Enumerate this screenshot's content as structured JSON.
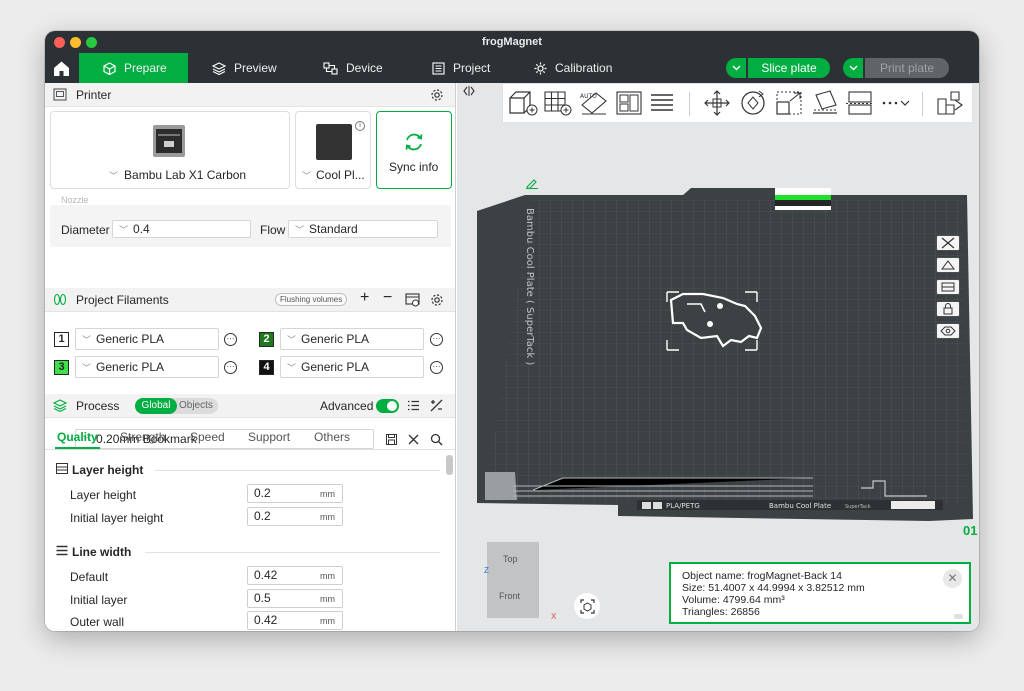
{
  "window": {
    "title": "frogMagnet"
  },
  "topbar": {
    "tabs": [
      {
        "label": "Prepare",
        "icon": "cube-icon",
        "active": true
      },
      {
        "label": "Preview",
        "icon": "layers-icon",
        "active": false
      },
      {
        "label": "Device",
        "icon": "device-icon",
        "active": false
      },
      {
        "label": "Project",
        "icon": "project-icon",
        "active": false
      },
      {
        "label": "Calibration",
        "icon": "calibration-icon",
        "active": false
      }
    ],
    "slice_label": "Slice plate",
    "print_label": "Print plate"
  },
  "printer": {
    "section_label": "Printer",
    "printer_name": "Bambu Lab X1 Carbon",
    "plate_name": "Cool Pl...",
    "sync_label": "Sync info",
    "nozzle_label": "Nozzle",
    "diameter_label": "Diameter",
    "diameter_value": "0.4",
    "flow_label": "Flow",
    "flow_value": "Standard"
  },
  "filaments": {
    "section_label": "Project Filaments",
    "flushing_label": "Flushing volumes",
    "items": [
      {
        "num": "1",
        "name": "Generic PLA",
        "color": "#ffffff",
        "text_color": "#262626"
      },
      {
        "num": "2",
        "name": "Generic PLA",
        "color": "#1f7a1f",
        "text_color": "#ffffff"
      },
      {
        "num": "3",
        "name": "Generic PLA",
        "color": "#3ee14a",
        "text_color": "#262626"
      },
      {
        "num": "4",
        "name": "Generic PLA",
        "color": "#111111",
        "text_color": "#ffffff"
      }
    ]
  },
  "process": {
    "section_label": "Process",
    "global_label": "Global",
    "objects_label": "Objects",
    "advanced_label": "Advanced",
    "advanced_on": true,
    "preset_value": "0.20mm Bookmark",
    "tabs": [
      "Quality",
      "Strength",
      "Speed",
      "Support",
      "Others"
    ],
    "groups": [
      {
        "title": "Layer height",
        "rows": [
          {
            "label": "Layer height",
            "value": "0.2",
            "unit": "mm"
          },
          {
            "label": "Initial layer height",
            "value": "0.2",
            "unit": "mm"
          }
        ]
      },
      {
        "title": "Line width",
        "rows": [
          {
            "label": "Default",
            "value": "0.42",
            "unit": "mm"
          },
          {
            "label": "Initial layer",
            "value": "0.5",
            "unit": "mm"
          },
          {
            "label": "Outer wall",
            "value": "0.42",
            "unit": "mm"
          }
        ]
      }
    ]
  },
  "viewport": {
    "plate_label": "Bambu Cool Plate ( SuperTack )",
    "plate_footer_left": "PLA/PETG",
    "plate_footer_right": "Bambu Cool Plate",
    "plate_footer_sub": "SuperTack",
    "plate_number": "01",
    "view_top": "Top",
    "view_front": "Front",
    "axis_z": "Z",
    "axis_x": "X"
  },
  "object_info": {
    "name_line": "Object name: frogMagnet-Back 14",
    "size_line": "Size: 51.4007 x 44.9994 x 3.82512 mm",
    "volume_line": "Volume: 4799.64 mm³",
    "triangles_line": "Triangles: 26856"
  },
  "colors": {
    "accent": "#00ae42",
    "topbar": "#2b3134",
    "plate": "#3c4144"
  }
}
